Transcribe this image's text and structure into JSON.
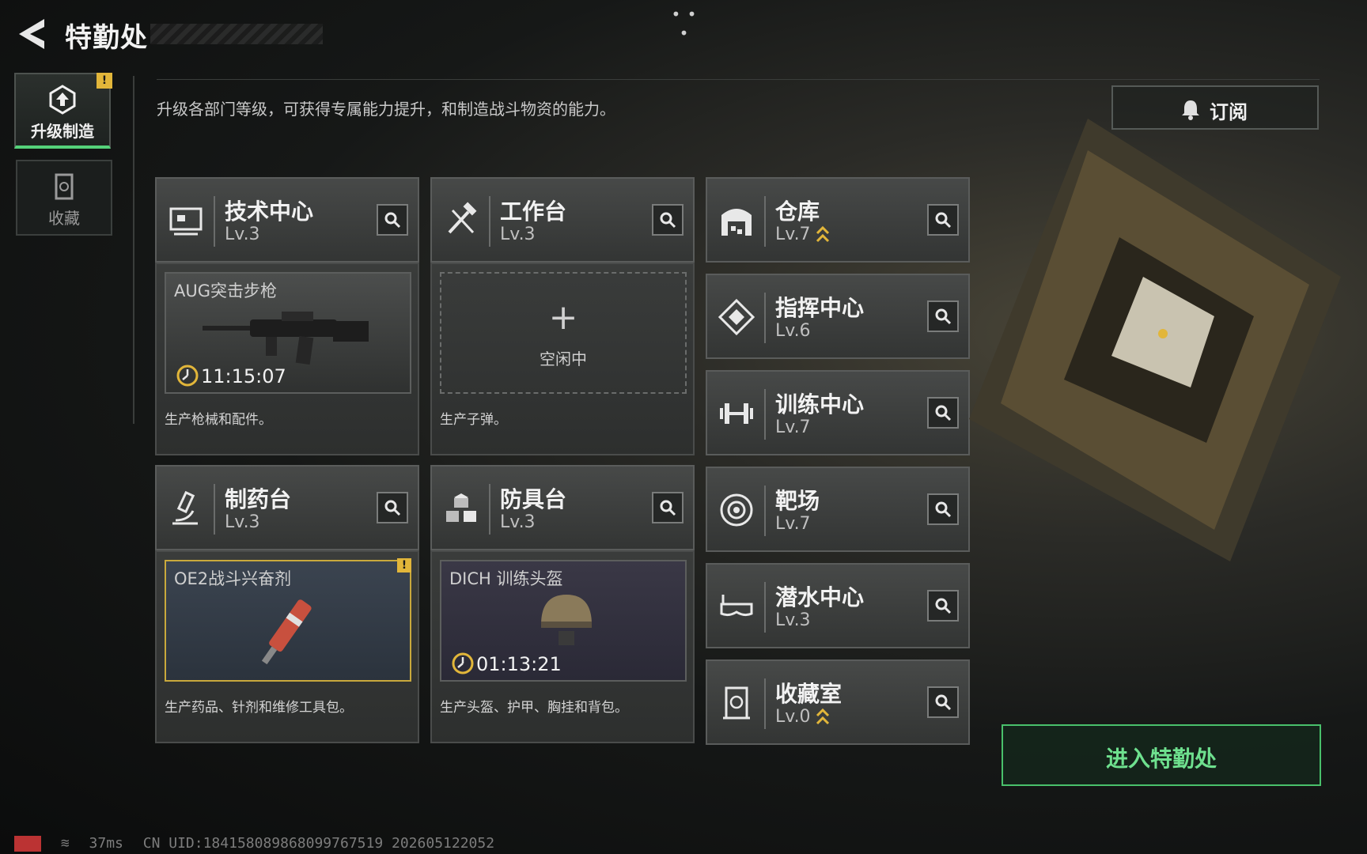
{
  "header": {
    "title": "特勤处"
  },
  "nav": [
    {
      "label": "升级制造",
      "icon": "upgrade-icon",
      "active": true,
      "alert": "!"
    },
    {
      "label": "收藏",
      "icon": "collection-icon",
      "active": false
    }
  ],
  "description": "升级各部门等级，可获得专属能力提升，和制造战斗物资的能力。",
  "subscribe_label": "订阅",
  "facilities": {
    "tech_center": {
      "name": "技术中心",
      "level": "Lv.3",
      "icon": "computer-icon",
      "production": {
        "item": "AUG突击步枪",
        "timer": "11:15:07"
      },
      "desc": "生产枪械和配件。"
    },
    "workbench": {
      "name": "工作台",
      "level": "Lv.3",
      "icon": "hammer-wrench-icon",
      "idle_plus": "+",
      "idle_label": "空闲中",
      "desc": "生产子弹。"
    },
    "pharmacy": {
      "name": "制药台",
      "level": "Lv.3",
      "icon": "microscope-icon",
      "production": {
        "item": "OE2战斗兴奋剂",
        "alert": "!"
      },
      "desc": "生产药品、针剂和维修工具包。"
    },
    "armor_bench": {
      "name": "防具台",
      "level": "Lv.3",
      "icon": "cubes-icon",
      "production": {
        "item": "DICH 训练头盔",
        "timer": "01:13:21"
      },
      "desc": "生产头盔、护甲、胸挂和背包。"
    },
    "warehouse": {
      "name": "仓库",
      "level": "Lv.7",
      "icon": "warehouse-icon",
      "upgradable": true
    },
    "command_center": {
      "name": "指挥中心",
      "level": "Lv.6",
      "icon": "command-icon"
    },
    "training_center": {
      "name": "训练中心",
      "level": "Lv.7",
      "icon": "dumbbell-icon"
    },
    "shooting_range": {
      "name": "靶场",
      "level": "Lv.7",
      "icon": "target-icon"
    },
    "dive_center": {
      "name": "潜水中心",
      "level": "Lv.3",
      "icon": "diving-mask-icon"
    },
    "collection_room": {
      "name": "收藏室",
      "level": "Lv.0",
      "icon": "collection-room-icon",
      "upgradable": true
    }
  },
  "enter_label": "进入特勤处",
  "status": {
    "ping": "37ms",
    "uid": "CN UID:184158089868099767519 202605122052"
  },
  "colors": {
    "accent_green": "#55d27a",
    "alert_yellow": "#e2b63a"
  }
}
